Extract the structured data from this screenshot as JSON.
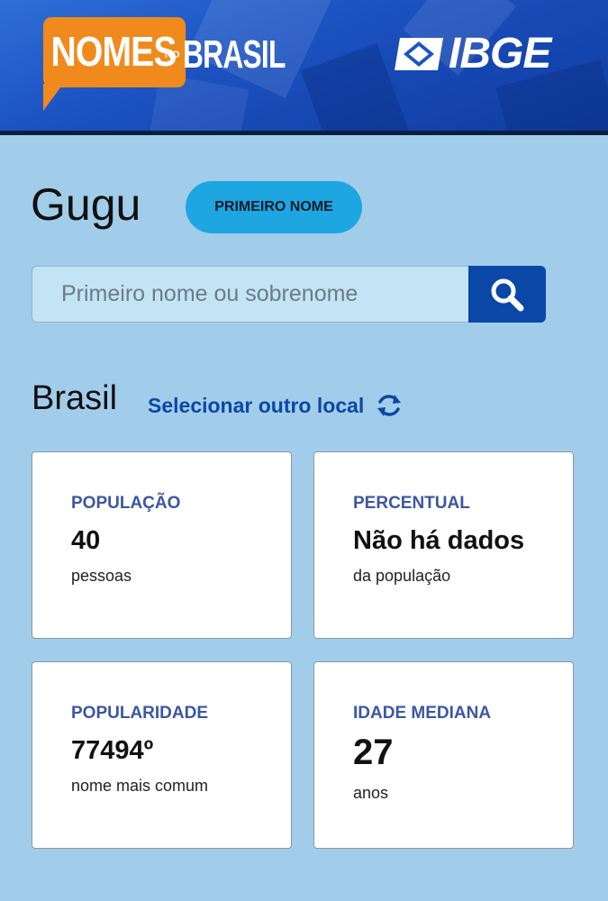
{
  "header": {
    "logo_nomes": "NOMES",
    "logo_no": "NO",
    "logo_brasil": "BRASIL",
    "logo_ibge": "IBGE",
    "background_color": "#1d55c4",
    "accent_orange": "#f08a1c"
  },
  "name": {
    "title": "Gugu",
    "type_badge": "PRIMEIRO NOME"
  },
  "search": {
    "placeholder": "Primeiro nome ou sobrenome",
    "value": "",
    "icon": "search-icon"
  },
  "location": {
    "name": "Brasil",
    "select_label": "Selecionar outro local",
    "icon": "refresh-icon"
  },
  "stats": {
    "population": {
      "label": "POPULAÇÃO",
      "value": "40",
      "unit": "pessoas"
    },
    "percentage": {
      "label": "PERCENTUAL",
      "value": "Não há dados",
      "unit": "da população"
    },
    "popularity": {
      "label": "POPULARIDADE",
      "value": "77494º",
      "unit": "nome mais comum"
    },
    "median_age": {
      "label": "IDADE MEDIANA",
      "value": "27",
      "unit": "anos"
    }
  },
  "colors": {
    "page_background": "#a2cdea",
    "badge": "#1da6e0",
    "search_button": "#0a47a6",
    "link": "#0c47a6",
    "card_label": "#3b57a0"
  }
}
